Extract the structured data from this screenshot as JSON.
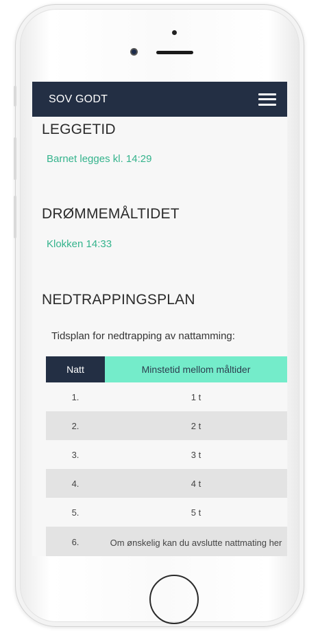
{
  "app": {
    "brand": "SOV GODT"
  },
  "sections": {
    "leggetid": {
      "title": "LEGGETID",
      "text": "Barnet legges kl. 14:29"
    },
    "drommemaltidet": {
      "title": "DRØMMEMÅLTIDET",
      "text": "Klokken 14:33"
    },
    "nedtrapping": {
      "title": "NEDTRAPPINGSPLAN",
      "intro": "Tidsplan for nedtrapping av nattamming:",
      "table": {
        "headers": [
          "Natt",
          "Minstetid mellom måltider"
        ],
        "rows": [
          {
            "natt": "1.",
            "tid": "1 t"
          },
          {
            "natt": "2.",
            "tid": "2 t"
          },
          {
            "natt": "3.",
            "tid": "3 t"
          },
          {
            "natt": "4.",
            "tid": "4 t"
          },
          {
            "natt": "5.",
            "tid": "5 t"
          },
          {
            "natt": "6.",
            "tid": "Om ønskelig kan du avslutte nattmating her"
          }
        ]
      }
    }
  },
  "colors": {
    "navbar": "#232f44",
    "accent": "#34b38c",
    "table_header_accent": "#74ecca"
  },
  "icons": {
    "menu": "hamburger-menu-icon"
  }
}
